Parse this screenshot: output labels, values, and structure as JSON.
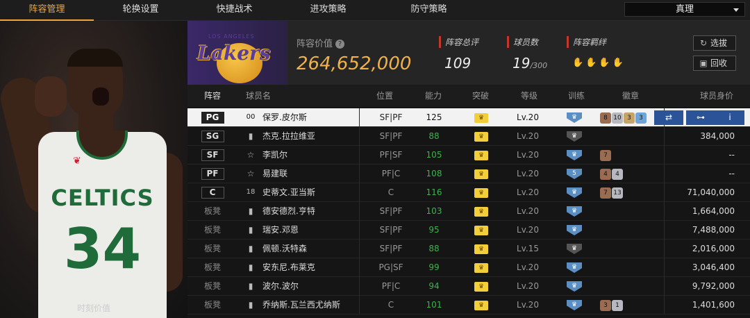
{
  "tabs": [
    "阵容管理",
    "轮换设置",
    "快捷战术",
    "进攻策略",
    "防守策略"
  ],
  "mode_select": "真理",
  "portrait": {
    "caption": "时刻价值",
    "jersey_word": "CELTICS",
    "jersey_number": "34"
  },
  "team": {
    "logo_text": "Lakers",
    "logo_small": "LOS ANGELES"
  },
  "lineup_value": {
    "label": "阵容价值",
    "value": "264,652,000"
  },
  "stats": {
    "rating_label": "阵容总评",
    "rating": "109",
    "players_label": "球员数",
    "players": "19",
    "players_max": "/300",
    "bond_label": "阵容羁绊"
  },
  "buttons": {
    "select": "选拔",
    "recycle": "回收"
  },
  "columns": {
    "lineup": "阵容",
    "name": "球员名",
    "position": "位置",
    "ability": "能力",
    "breakthrough": "突破",
    "level": "等级",
    "training": "训练",
    "badges": "徽章",
    "salary": "球员身价"
  },
  "players": [
    {
      "slot": "PG",
      "icon": "00",
      "name": "保罗.皮尔斯",
      "pos": "SF|PF",
      "ovr": "125",
      "level": "Lv.20",
      "train": "",
      "badges": [
        [
          "b",
          "8"
        ],
        [
          "s",
          "10"
        ],
        [
          "g",
          "3"
        ],
        [
          "bl",
          "3"
        ]
      ],
      "salary": "",
      "selected": true
    },
    {
      "slot": "SG",
      "icon": "bars",
      "name": "杰克.拉拉维亚",
      "pos": "SF|PF",
      "ovr": "88",
      "level": "Lv.20",
      "train": "",
      "train_dark": true,
      "badges": [],
      "salary": "384,000"
    },
    {
      "slot": "SF",
      "icon": "star",
      "name": "李凯尔",
      "pos": "PF|SF",
      "ovr": "105",
      "level": "Lv.20",
      "train": "",
      "badges": [
        [
          "b",
          "7"
        ]
      ],
      "salary": "--"
    },
    {
      "slot": "PF",
      "icon": "star",
      "name": "易建联",
      "pos": "PF|C",
      "ovr": "108",
      "level": "Lv.20",
      "train": "5",
      "badges": [
        [
          "b",
          "4"
        ],
        [
          "s",
          "4"
        ]
      ],
      "salary": "--"
    },
    {
      "slot": "C",
      "icon": "18",
      "name": "史蒂文.亚当斯",
      "pos": "C",
      "ovr": "116",
      "level": "Lv.20",
      "train": "",
      "badges": [
        [
          "b",
          "7"
        ],
        [
          "s",
          "13"
        ]
      ],
      "salary": "71,040,000"
    },
    {
      "slot": "板凳",
      "icon": "bars",
      "name": "德安德烈.亨特",
      "pos": "SF|PF",
      "ovr": "103",
      "level": "Lv.20",
      "train": "",
      "badges": [],
      "salary": "1,664,000"
    },
    {
      "slot": "板凳",
      "icon": "bars",
      "name": "瑞安.邓恩",
      "pos": "SF|PF",
      "ovr": "95",
      "level": "Lv.20",
      "train": "",
      "badges": [],
      "salary": "7,488,000"
    },
    {
      "slot": "板凳",
      "icon": "bars",
      "name": "佩顿.沃特森",
      "pos": "SF|PF",
      "ovr": "88",
      "level": "Lv.15",
      "train": "",
      "train_dark": true,
      "badges": [],
      "salary": "2,016,000"
    },
    {
      "slot": "板凳",
      "icon": "bars",
      "name": "安东尼.布莱克",
      "pos": "PG|SF",
      "ovr": "99",
      "level": "Lv.20",
      "train": "",
      "badges": [],
      "salary": "3,046,400"
    },
    {
      "slot": "板凳",
      "icon": "bars",
      "name": "波尔.波尔",
      "pos": "PF|C",
      "ovr": "94",
      "level": "Lv.20",
      "train": "",
      "badges": [],
      "salary": "9,792,000"
    },
    {
      "slot": "板凳",
      "icon": "bars",
      "name": "乔纳斯.瓦兰西尤纳斯",
      "pos": "C",
      "ovr": "101",
      "level": "Lv.20",
      "train": "",
      "badges": [
        [
          "b",
          "3"
        ],
        [
          "s",
          "1"
        ]
      ],
      "salary": "1,401,600"
    }
  ],
  "colors": {
    "accent": "#f0a640",
    "value": "#f0b24a",
    "green": "#3bb54a",
    "blue_btn": "#2a5497"
  }
}
